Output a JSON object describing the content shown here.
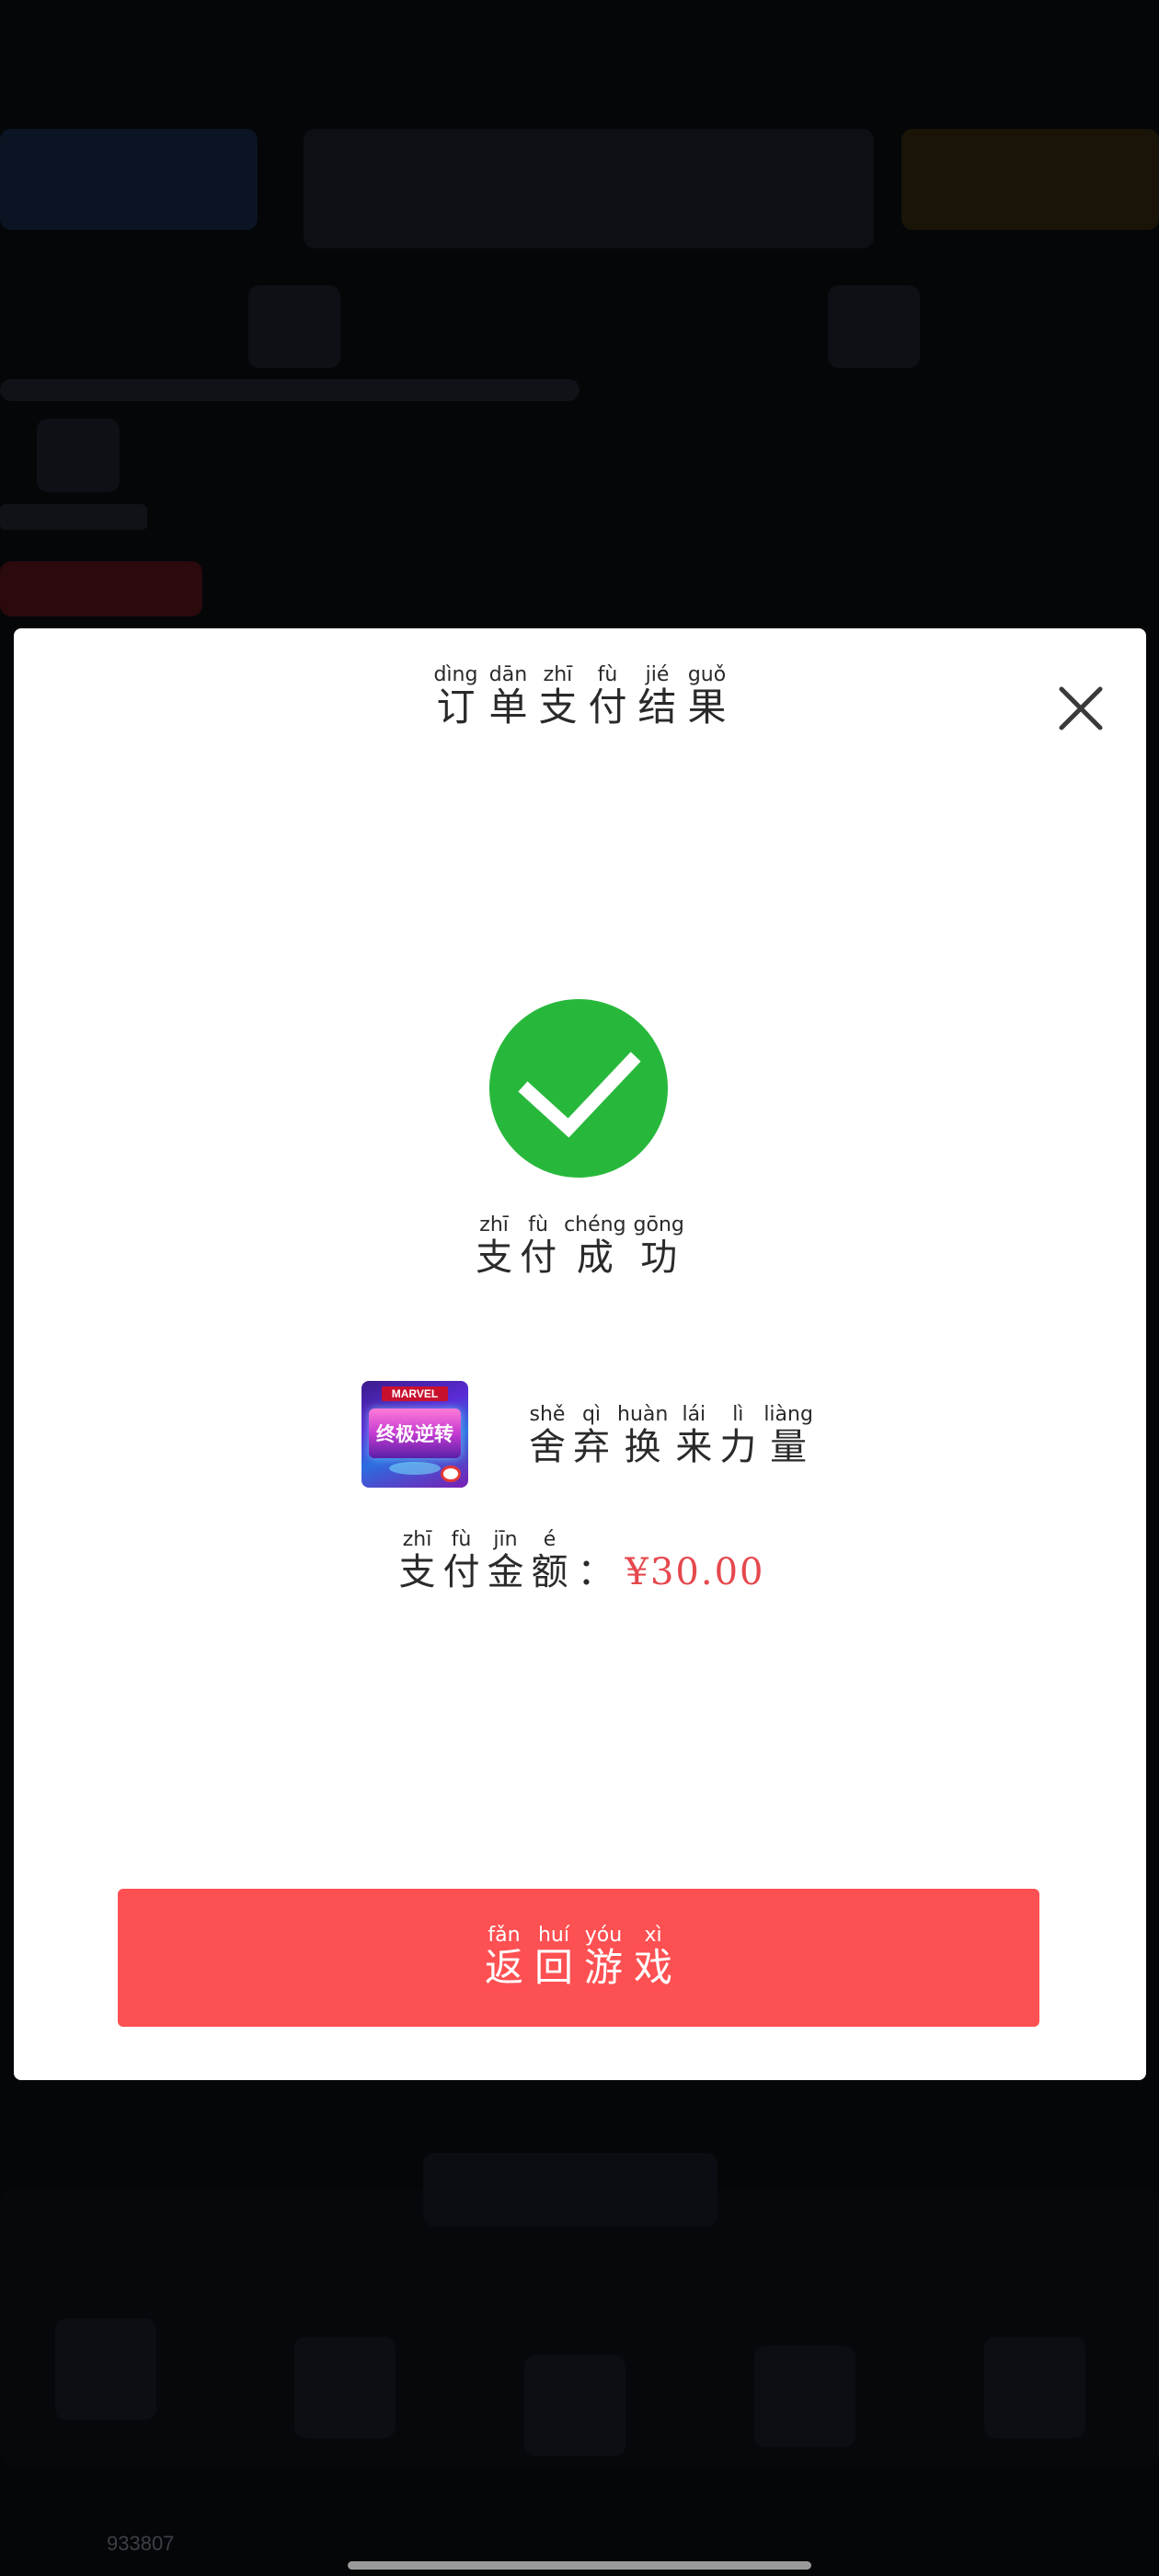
{
  "dialog": {
    "title": [
      {
        "hz": "订",
        "py": "dìng"
      },
      {
        "hz": "单",
        "py": "dān"
      },
      {
        "hz": "支",
        "py": "zhī"
      },
      {
        "hz": "付",
        "py": "fù"
      },
      {
        "hz": "结",
        "py": "jié"
      },
      {
        "hz": "果",
        "py": "guǒ"
      }
    ],
    "close_icon": "close-icon",
    "status_icon": "check-circle-icon",
    "status": [
      {
        "hz": "支",
        "py": "zhī"
      },
      {
        "hz": "付",
        "py": "fù"
      },
      {
        "hz": "成",
        "py": "chéng"
      },
      {
        "hz": "功",
        "py": "gōng"
      }
    ],
    "product": {
      "icon_brand": "MARVEL",
      "icon_title": "终极逆转",
      "name": [
        {
          "hz": "舍",
          "py": "shě"
        },
        {
          "hz": "弃",
          "py": "qì"
        },
        {
          "hz": "换",
          "py": "huàn"
        },
        {
          "hz": "来",
          "py": "lái"
        },
        {
          "hz": "力",
          "py": "lì"
        },
        {
          "hz": "量",
          "py": "liàng"
        }
      ]
    },
    "amount": {
      "label": [
        {
          "hz": "支",
          "py": "zhī"
        },
        {
          "hz": "付",
          "py": "fù"
        },
        {
          "hz": "金",
          "py": "jīn"
        },
        {
          "hz": "额",
          "py": "é"
        }
      ],
      "colon": "：",
      "value": "¥30.00"
    },
    "return_button": [
      {
        "hz": "返",
        "py": "fǎn"
      },
      {
        "hz": "回",
        "py": "huí"
      },
      {
        "hz": "游",
        "py": "yóu"
      },
      {
        "hz": "戏",
        "py": "xì"
      }
    ]
  },
  "footer": {
    "code": "933807"
  },
  "colors": {
    "accent": "#fd5052",
    "success": "#27b83b",
    "price": "#e5484d",
    "backdrop": "#050608"
  }
}
